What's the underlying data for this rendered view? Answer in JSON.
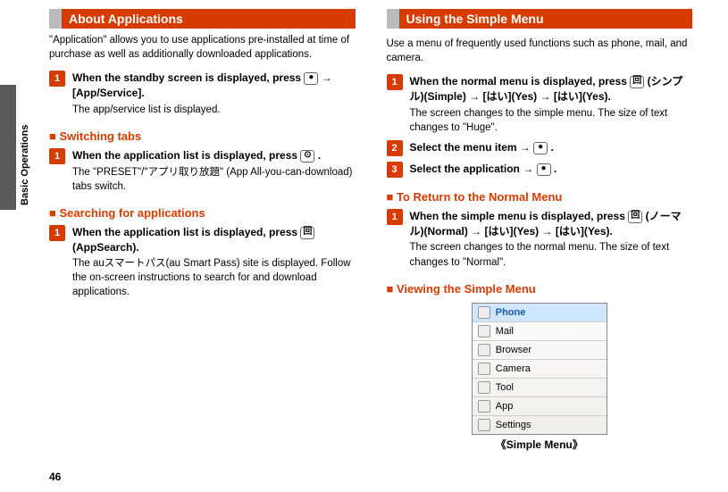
{
  "side_label": "Basic Operations",
  "page_number": "46",
  "left": {
    "header": "About Applications",
    "intro": "\"Application\" allows you to use applications pre-installed at time of purchase as well as additionally downloaded applications.",
    "steps_a": [
      {
        "num": "1",
        "title_pre": "When the standby screen is displayed, press ",
        "title_post_1": " → [App/Service].",
        "desc": "The app/service list is displayed."
      }
    ],
    "sub_switch": "Switching tabs",
    "steps_b": [
      {
        "num": "1",
        "title_pre": "When the application list is displayed, press ",
        "title_post": ".",
        "desc": "The \"PRESET\"/\"アプリ取り放題\" (App All-you-can-download) tabs switch."
      }
    ],
    "sub_search": "Searching for applications",
    "steps_c": [
      {
        "num": "1",
        "title_pre": "When the application list is displayed, press ",
        "key_label": "回",
        "title_post": " (AppSearch).",
        "desc": "The auスマートパス(au Smart Pass) site is displayed. Follow the on-screen instructions to search for and download applications."
      }
    ]
  },
  "right": {
    "header": "Using the Simple Menu",
    "intro": "Use a menu of frequently used functions such as phone, mail, and camera.",
    "steps_a": [
      {
        "num": "1",
        "title_pre": "When the normal menu is displayed, press ",
        "key_label": "回",
        "title_post": " (シンプル)(Simple) → [はい](Yes) → [はい](Yes).",
        "desc": "The screen changes to the simple menu. The size of text changes to \"Huge\"."
      },
      {
        "num": "2",
        "title_pre": "Select the menu item → ",
        "title_post": "."
      },
      {
        "num": "3",
        "title_pre": "Select the application  → ",
        "title_post": "."
      }
    ],
    "sub_return": "To Return to the Normal Menu",
    "steps_b": [
      {
        "num": "1",
        "title_pre": "When the simple menu is displayed, press ",
        "key_label": "回",
        "title_post": " (ノーマル)(Normal) → [はい](Yes) → [はい](Yes).",
        "desc": "The screen changes to the normal menu. The size of text changes to \"Normal\"."
      }
    ],
    "sub_view": "Viewing the Simple Menu",
    "menu_items": [
      "Phone",
      "Mail",
      "Browser",
      "Camera",
      "Tool",
      "App",
      "Settings"
    ],
    "caption": "《Simple Menu》"
  }
}
